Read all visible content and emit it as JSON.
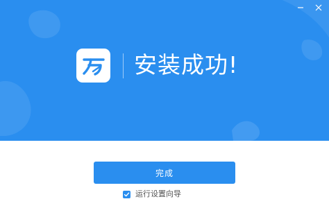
{
  "window": {
    "minimize_icon": "minimize-icon",
    "close_icon": "close-icon"
  },
  "banner": {
    "logo_icon": "app-logo-icon",
    "title": "安装成功!"
  },
  "actions": {
    "finish_label": "完成",
    "run_wizard_label": "运行设置向导",
    "run_wizard_checked": true
  },
  "colors": {
    "accent": "#2a8eef",
    "banner_bg": "#2a8eef",
    "text_muted": "#555555"
  }
}
